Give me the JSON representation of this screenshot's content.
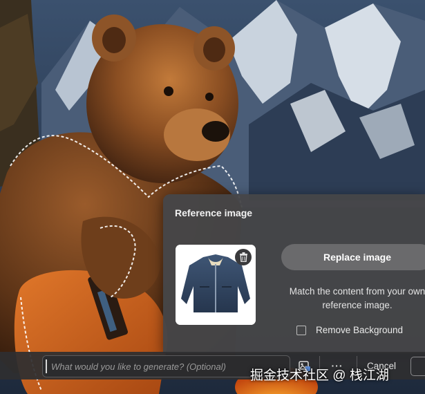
{
  "panel": {
    "title": "Reference image",
    "replace_label": "Replace image",
    "description": "Match the content from your own reference image.",
    "remove_bg_label": "Remove Background",
    "remove_bg_checked": false
  },
  "bottom_bar": {
    "prompt_placeholder": "What would you like to generate? (Optional)",
    "prompt_value": "",
    "more_label": "···",
    "cancel_label": "Cancel"
  },
  "watermark": "掘金技术社区 @ 栈江湖",
  "icons": {
    "trash": "trash-icon",
    "reference": "reference-image-icon",
    "more": "more-options-icon"
  },
  "colors": {
    "panel_bg": "#464648",
    "button_bg": "#6a6a6c",
    "bar_bg": "#2e2e30",
    "selection_outline": "#ffffff"
  }
}
